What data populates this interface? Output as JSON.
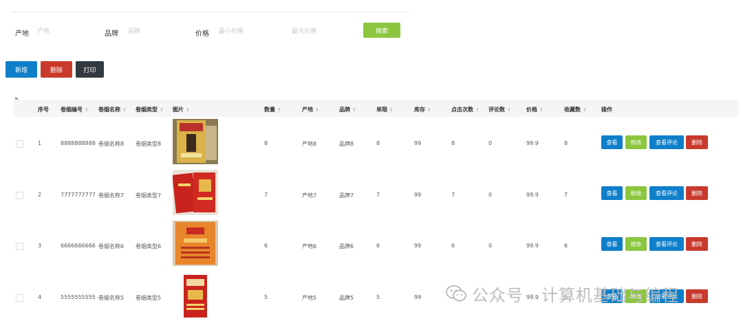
{
  "filters": {
    "origin_label": "产地",
    "origin_placeholder": "产地",
    "brand_label": "品牌",
    "brand_placeholder": "品牌",
    "price_label": "价格",
    "price_min_placeholder": "最小价格",
    "price_max_placeholder": "最大价格",
    "search_label": "搜索"
  },
  "actions": {
    "add_label": "新增",
    "delete_label": "删除",
    "print_label": "打印"
  },
  "table": {
    "headers": {
      "index": "序号",
      "code": "卷烟编号",
      "name": "卷烟名称",
      "type": "卷烟类型",
      "image": "图片",
      "quantity": "数量",
      "origin": "产地",
      "brand": "品牌",
      "unit": "单限",
      "stock": "库存",
      "clicks": "点击次数",
      "comments": "评论数",
      "price": "价格",
      "favorites": "收藏数",
      "operations": "操作"
    },
    "rows": [
      {
        "index": "1",
        "code": "8888888888",
        "name": "卷烟名称8",
        "type": "卷烟类型8",
        "quantity": "8",
        "origin": "产地8",
        "brand": "品牌8",
        "unit": "8",
        "stock": "99",
        "clicks": "8",
        "comments": "0",
        "price": "99.9",
        "favorites": "8"
      },
      {
        "index": "2",
        "code": "7777777777",
        "name": "卷烟名称7",
        "type": "卷烟类型7",
        "quantity": "7",
        "origin": "产地7",
        "brand": "品牌7",
        "unit": "7",
        "stock": "99",
        "clicks": "7",
        "comments": "0",
        "price": "99.9",
        "favorites": "7"
      },
      {
        "index": "3",
        "code": "6666666666",
        "name": "卷烟名称6",
        "type": "卷烟类型6",
        "quantity": "6",
        "origin": "产地6",
        "brand": "品牌6",
        "unit": "6",
        "stock": "99",
        "clicks": "6",
        "comments": "0",
        "price": "99.9",
        "favorites": "6"
      },
      {
        "index": "4",
        "code": "5555555555",
        "name": "卷烟名称5",
        "type": "卷烟类型5",
        "quantity": "5",
        "origin": "产地5",
        "brand": "品牌5",
        "unit": "5",
        "stock": "99",
        "clicks": "",
        "comments": "",
        "price": "99.9",
        "favorites": "5"
      }
    ],
    "row_buttons": {
      "view": "查看",
      "edit": "修改",
      "view_comments": "查看评论",
      "delete": "删除"
    }
  },
  "watermark": {
    "text": "公众号 · 计算机基础与编程"
  },
  "colors": {
    "primary_blue": "#0f7fc9",
    "success_green": "#8cc63f",
    "danger_red": "#c93a2c",
    "dark": "#333a3f"
  }
}
